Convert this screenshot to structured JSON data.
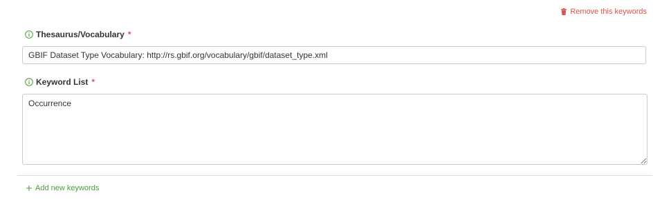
{
  "remove_link": {
    "icon": "trash-icon",
    "label": "Remove this keywords",
    "color": "#d9534f"
  },
  "thesaurus": {
    "info_icon": "info-circle-icon",
    "label": "Thesaurus/Vocabulary",
    "required_marker": "*",
    "value": "GBIF Dataset Type Vocabulary: http://rs.gbif.org/vocabulary/gbif/dataset_type.xml"
  },
  "keyword_list": {
    "info_icon": "info-circle-icon",
    "label": "Keyword List",
    "required_marker": "*",
    "value": "Occurrence"
  },
  "add_link": {
    "icon": "plus-icon",
    "label": "Add new keywords",
    "color": "#4c9a3e"
  },
  "colors": {
    "info_icon": "#4c9a3e",
    "required": "#d9534f",
    "border": "#cccccc"
  }
}
